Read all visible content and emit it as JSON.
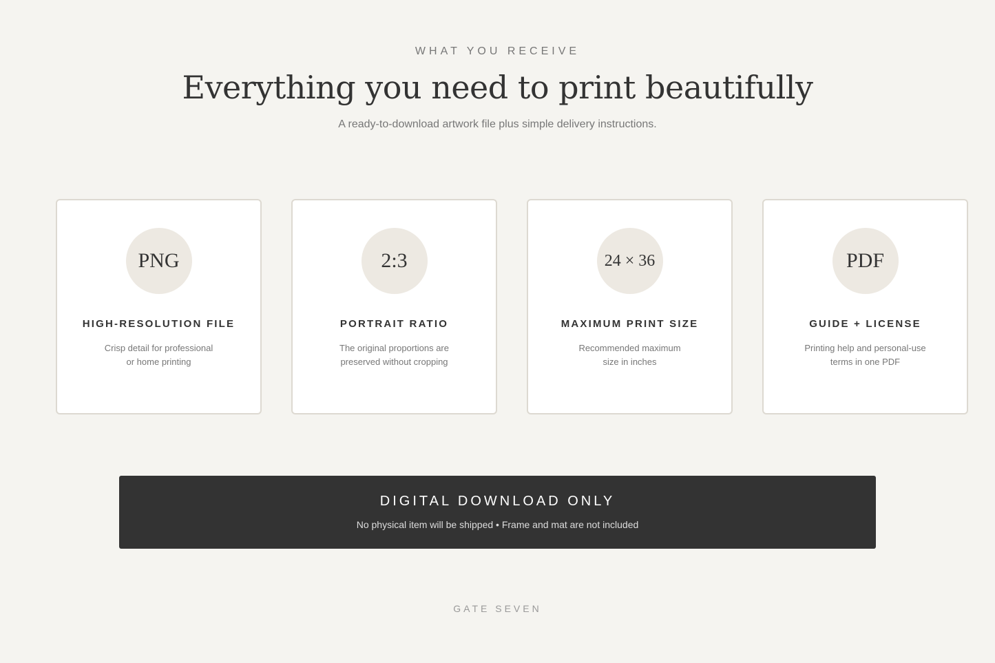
{
  "header": {
    "eyebrow": "WHAT YOU RECEIVE",
    "title": "Everything you need to print beautifully",
    "subtitle": "A ready-to-download artwork file plus simple delivery instructions."
  },
  "cards": [
    {
      "badge": "PNG",
      "title": "HIGH-RESOLUTION FILE",
      "desc_line1": "Crisp detail for professional",
      "desc_line2": "or home printing"
    },
    {
      "badge": "2:3",
      "title": "PORTRAIT RATIO",
      "desc_line1": "The original proportions are",
      "desc_line2": "preserved without cropping"
    },
    {
      "badge": "24 × 36",
      "title": "MAXIMUM PRINT SIZE",
      "desc_line1": "Recommended maximum",
      "desc_line2": "size in inches"
    },
    {
      "badge": "PDF",
      "title": "GUIDE + LICENSE",
      "desc_line1": "Printing help and personal-use",
      "desc_line2": "terms in one PDF"
    }
  ],
  "banner": {
    "title": "DIGITAL DOWNLOAD ONLY",
    "subtitle": "No physical item will be shipped • Frame and mat are not included"
  },
  "footer": {
    "brand": "GATE SEVEN"
  },
  "colors": {
    "background": "#f5f4f0",
    "card_border": "#ddd9d1",
    "badge_bg": "#ede9e2",
    "banner_bg": "#333333"
  }
}
